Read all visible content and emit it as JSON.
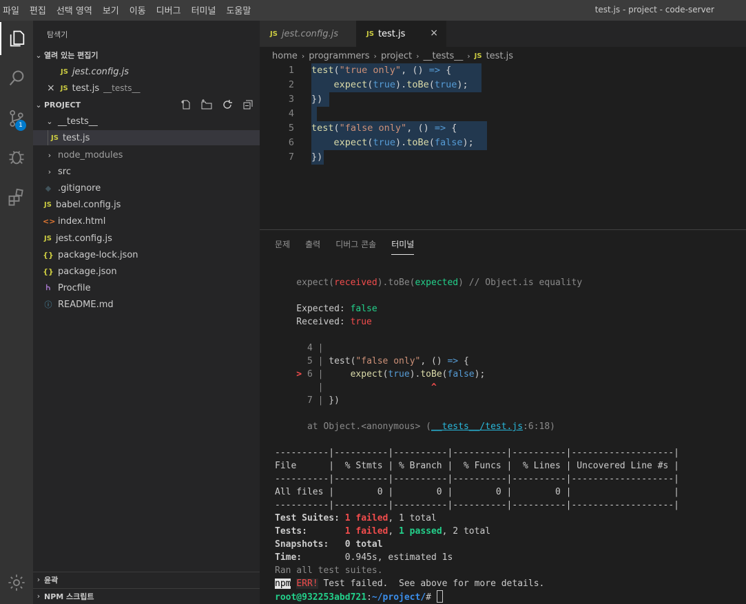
{
  "menu": [
    "파일",
    "편집",
    "선택 영역",
    "보기",
    "이동",
    "디버그",
    "터미널",
    "도움말"
  ],
  "window_title": "test.js - project - code-server",
  "activity": {
    "scm_badge": "1"
  },
  "sidebar": {
    "title": "탐색기",
    "open_editors_label": "열려 있는 편집기",
    "open_editors": [
      {
        "icon": "JS",
        "name": "jest.config.js",
        "path": ""
      },
      {
        "icon": "JS",
        "name": "test.js",
        "path": "__tests__"
      }
    ],
    "project_label": "PROJECT",
    "tree": [
      {
        "icon": "chevron-down",
        "name": "__tests__"
      },
      {
        "icon": "JS",
        "name": "test.js"
      },
      {
        "icon": "chevron-right",
        "name": "node_modules"
      },
      {
        "icon": "chevron-right",
        "name": "src"
      },
      {
        "icon": "diamond",
        "name": ".gitignore"
      },
      {
        "icon": "JS",
        "name": "babel.config.js"
      },
      {
        "icon": "<>",
        "name": "index.html"
      },
      {
        "icon": "JS",
        "name": "jest.config.js"
      },
      {
        "icon": "{}",
        "name": "package-lock.json"
      },
      {
        "icon": "{}",
        "name": "package.json"
      },
      {
        "icon": "heroku",
        "name": "Procfile"
      },
      {
        "icon": "info",
        "name": "README.md"
      }
    ],
    "outline_label": "윤곽",
    "npm_label": "NPM 스크립트"
  },
  "tabs": [
    {
      "icon": "JS",
      "label": "jest.config.js"
    },
    {
      "icon": "JS",
      "label": "test.js",
      "close": "×"
    }
  ],
  "breadcrumb": [
    "home",
    "programmers",
    "project",
    "__tests__",
    "test.js"
  ],
  "breadcrumb_js": "JS",
  "editor": {
    "line_numbers": [
      "1",
      "2",
      "3",
      "4",
      "5",
      "6",
      "7"
    ]
  },
  "panel": {
    "tabs": [
      "문제",
      "출력",
      "디버그 콘솔",
      "터미널"
    ],
    "active_tab": "터미널"
  },
  "terminal": {
    "coverage_header": "File      |  % Stmts | % Branch |  % Funcs |  % Lines | Uncovered Line #s |",
    "coverage_sep": "----------|----------|----------|----------|----------|-------------------|",
    "coverage_row": "All files |        0 |        0 |        0 |        0 |                   |",
    "suites_label": "Test Suites: ",
    "suites_failed": "1 failed",
    "suites_total": ", 1 total",
    "tests_label": "Tests:       ",
    "tests_failed": "1 failed",
    "tests_passed": "1 passed",
    "tests_total": ", 2 total",
    "snapshots": "Snapshots:   0 total",
    "time_label": "Time:        ",
    "time_value": "0.945s, estimated 1s",
    "ran": "Ran all test suites.",
    "npm": "npm",
    "err": "ERR!",
    "err_msg": " Test failed.  See above for more details.",
    "prompt_user": "root@932253abd721",
    "prompt_path": "~/project/",
    "prompt_hash": "# "
  }
}
